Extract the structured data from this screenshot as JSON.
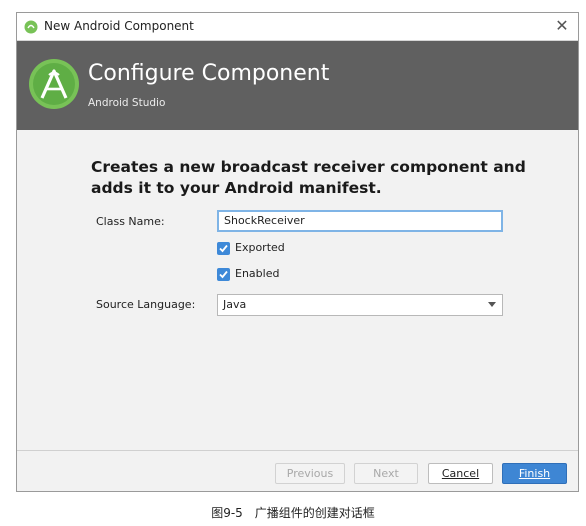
{
  "window": {
    "title": "New Android Component",
    "close_glyph": "✕"
  },
  "header": {
    "title": "Configure Component",
    "subtitle": "Android Studio",
    "logo_icon": "android-studio-logo-icon"
  },
  "content": {
    "headline": "Creates a new broadcast receiver component and adds it to your Android manifest.",
    "class_name_label": "Class Name:",
    "class_name_value": "ShockReceiver",
    "exported_label": "Exported",
    "exported_checked": true,
    "enabled_label": "Enabled",
    "enabled_checked": true,
    "source_language_label": "Source Language:",
    "source_language_value": "Java"
  },
  "footer": {
    "previous_label": "Previous",
    "next_label": "Next",
    "cancel_label": "Cancel",
    "finish_label": "Finish"
  },
  "caption": "图9-5　广播组件的创建对话框",
  "colors": {
    "header_bg": "#606060",
    "accent_blue": "#3e86d4",
    "logo_green": "#78c257"
  }
}
